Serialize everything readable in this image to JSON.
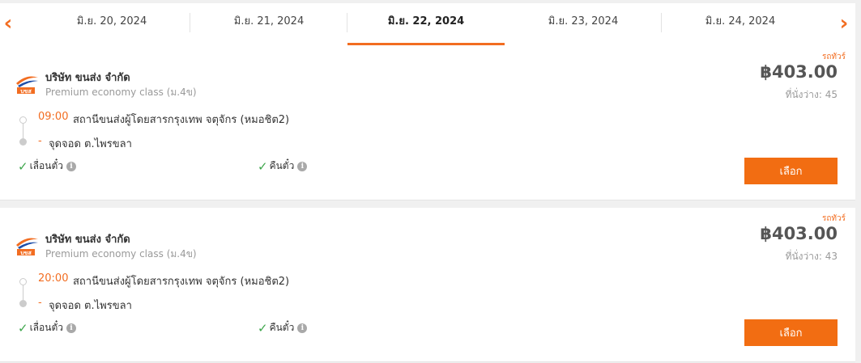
{
  "date_nav": {
    "prev_icon": "chevron-left-icon",
    "next_icon": "chevron-right-icon",
    "prev_glyph": "‹",
    "next_glyph": "›",
    "dates": [
      {
        "label": "มิ.ย. 20, 2024",
        "active": false
      },
      {
        "label": "มิ.ย. 21, 2024",
        "active": false
      },
      {
        "label": "มิ.ย. 22, 2024",
        "active": true
      },
      {
        "label": "มิ.ย. 23, 2024",
        "active": false
      },
      {
        "label": "มิ.ย. 24, 2024",
        "active": false
      }
    ]
  },
  "trips": [
    {
      "tag": "รถทัวร์",
      "operator": "บริษัท ขนส่ง จำกัด",
      "class": "Premium economy class (ม.4ข)",
      "price": "฿403.00",
      "seats": "ที่นั่งว่าง: 45",
      "departure_time": "09:00",
      "departure_place": "สถานีขนส่งผู้โดยสารกรุงเทพ จตุจักร (หมอชิต2)",
      "arrival_dash": "-",
      "arrival_place": "จุดจอด ต.ไพรขลา",
      "feature_reschedule": "เลื่อนตั๋ว",
      "feature_refund": "คืนตั๋ว",
      "check_glyph": "✓",
      "info_glyph": "i",
      "select_label": "เลือก"
    },
    {
      "tag": "รถทัวร์",
      "operator": "บริษัท ขนส่ง จำกัด",
      "class": "Premium economy class (ม.4ข)",
      "price": "฿403.00",
      "seats": "ที่นั่งว่าง: 43",
      "departure_time": "20:00",
      "departure_place": "สถานีขนส่งผู้โดยสารกรุงเทพ จตุจักร (หมอชิต2)",
      "arrival_dash": "-",
      "arrival_place": "จุดจอด ต.ไพรขลา",
      "feature_reschedule": "เลื่อนตั๋ว",
      "feature_refund": "คืนตั๋ว",
      "check_glyph": "✓",
      "info_glyph": "i",
      "select_label": "เลือก"
    }
  ],
  "logo": {
    "text": "บขส",
    "accent": "#f26d21",
    "secondary": "#1e4ea8"
  },
  "colors": {
    "accent": "#f26d21",
    "check": "#3ea64c"
  }
}
